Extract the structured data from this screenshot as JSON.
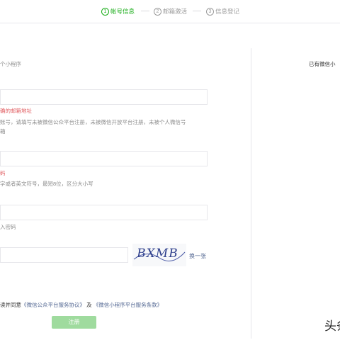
{
  "steps": [
    {
      "num": "1",
      "label": "帐号信息"
    },
    {
      "num": "2",
      "label": "邮箱激活"
    },
    {
      "num": "3",
      "label": "信息登记"
    }
  ],
  "form": {
    "intro": "个小程序",
    "email_error": "确的邮箱地址",
    "email_hint_1": "账号，请填写未被微信公众平台注册，未被微信开放平台注册，未被个人微信号",
    "email_hint_2": "箱",
    "password_error": "码",
    "password_hint": "字或者英文符号，最短8位，区分大小写",
    "confirm_hint": "入密码",
    "captcha_text": "BXMB",
    "refresh_captcha": "换一张",
    "agree_prefix": "读并同意",
    "agreement_1": "《微信公众平台服务协议》",
    "agree_and": "及",
    "agreement_2": "《微信小程序平台服务条款》",
    "submit_label": "注册"
  },
  "side": {
    "have_account": "已有微信小"
  },
  "watermark": "头条"
}
